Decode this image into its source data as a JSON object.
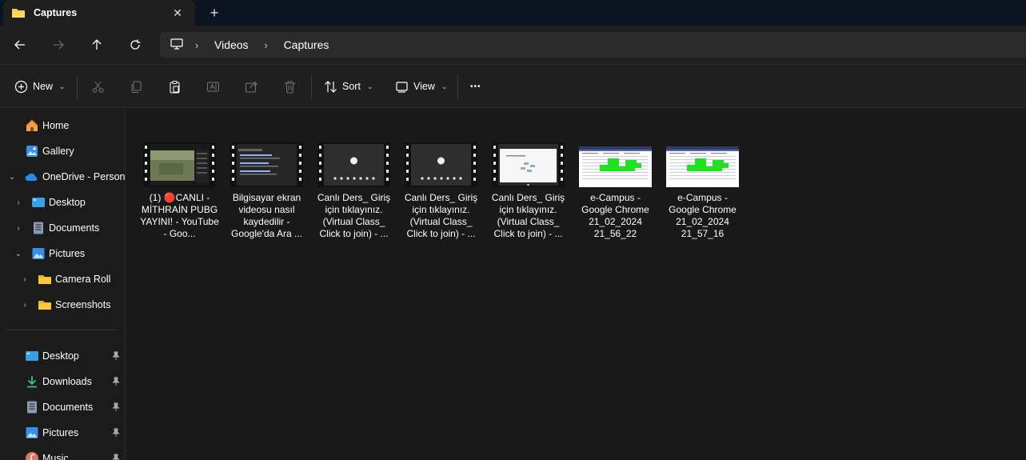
{
  "window": {
    "tab_title": "Captures",
    "close_glyph": "✕",
    "new_tab_glyph": "+"
  },
  "address": {
    "segments": [
      "Videos",
      "Captures"
    ],
    "separator": "›"
  },
  "toolbar": {
    "new_label": "New",
    "sort_label": "Sort",
    "view_label": "View",
    "caret": "⌄",
    "more_glyph": "•••"
  },
  "sidebar": {
    "items": [
      {
        "label": "Home",
        "icon": "home-icon"
      },
      {
        "label": "Gallery",
        "icon": "gallery-icon"
      },
      {
        "label": "OneDrive - Persona",
        "icon": "onedrive-icon"
      },
      {
        "label": "Desktop",
        "icon": "desktop-folder-icon"
      },
      {
        "label": "Documents",
        "icon": "documents-folder-icon"
      },
      {
        "label": "Pictures",
        "icon": "pictures-folder-icon"
      },
      {
        "label": "Camera Roll",
        "icon": "folder-icon"
      },
      {
        "label": "Screenshots",
        "icon": "folder-icon"
      }
    ],
    "pinned": [
      {
        "label": "Desktop",
        "icon": "desktop-folder-icon"
      },
      {
        "label": "Downloads",
        "icon": "downloads-icon"
      },
      {
        "label": "Documents",
        "icon": "documents-folder-icon"
      },
      {
        "label": "Pictures",
        "icon": "pictures-folder-icon"
      },
      {
        "label": "Music",
        "icon": "music-icon"
      }
    ]
  },
  "files": [
    {
      "name": "(1) 🔴CANLI - MİTHRAİN PUBG YAYINI! - YouTube - Goo...",
      "type": "video"
    },
    {
      "name": "Bilgisayar ekran videosu nasıl kaydedilir - Google'da Ara ...",
      "type": "video"
    },
    {
      "name": "Canlı Ders_ Giriş için tıklayınız. (Virtual Class_ Click to join) - ...",
      "type": "video"
    },
    {
      "name": "Canlı Ders_ Giriş için tıklayınız. (Virtual Class_ Click to join) - ...",
      "type": "video"
    },
    {
      "name": "Canlı Ders_ Giriş için tıklayınız. (Virtual Class_ Click to join) - ...",
      "type": "video"
    },
    {
      "name": "e-Campus - Google Chrome 21_02_2024 21_56_22",
      "type": "image"
    },
    {
      "name": "e-Campus - Google Chrome 21_02_2024 21_57_16",
      "type": "image"
    }
  ],
  "colors": {
    "accent_blue": "#4cc2ff",
    "folder_yellow": "#f8c93c",
    "highlight_green": "#22e022",
    "background": "#191919"
  }
}
